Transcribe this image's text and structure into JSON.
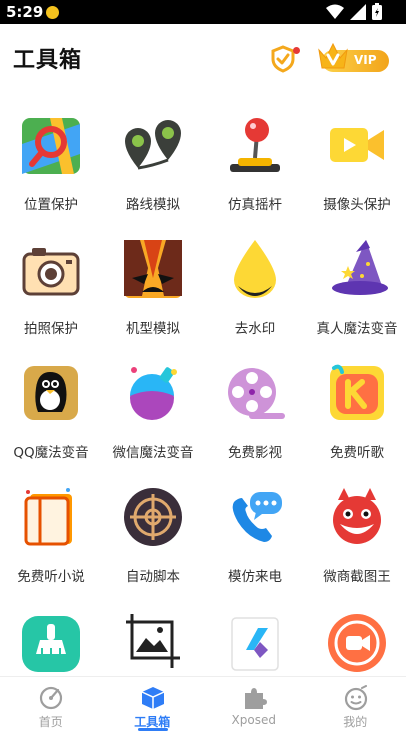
{
  "status_bar": {
    "time": "5:29"
  },
  "header": {
    "title": "工具箱",
    "vip_label": "VIP"
  },
  "tools": [
    {
      "label": "位置保护"
    },
    {
      "label": "路线模拟"
    },
    {
      "label": "仿真摇杆"
    },
    {
      "label": "摄像头保护"
    },
    {
      "label": "拍照保护"
    },
    {
      "label": "机型模拟"
    },
    {
      "label": "去水印"
    },
    {
      "label": "真人魔法变音"
    },
    {
      "label": "QQ魔法变音"
    },
    {
      "label": "微信魔法变音"
    },
    {
      "label": "免费影视"
    },
    {
      "label": "免费听歌"
    },
    {
      "label": "免费听小说"
    },
    {
      "label": "自动脚本"
    },
    {
      "label": "模仿来电"
    },
    {
      "label": "微商截图王"
    },
    {
      "label": ""
    },
    {
      "label": ""
    },
    {
      "label": ""
    },
    {
      "label": ""
    }
  ],
  "tabbar": {
    "tabs": [
      {
        "label": "首页",
        "active": false
      },
      {
        "label": "工具箱",
        "active": true
      },
      {
        "label": "Xposed",
        "active": false
      },
      {
        "label": "我的",
        "active": false
      }
    ],
    "active_color": "#2f7df6",
    "inactive_color": "#9e9e9e"
  }
}
